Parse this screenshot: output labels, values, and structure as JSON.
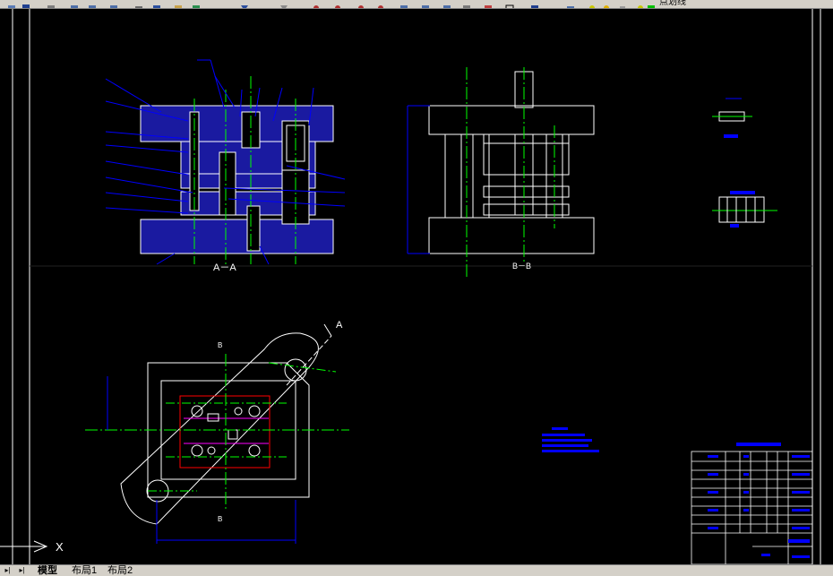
{
  "toolbar": {
    "layer_label": "点划线",
    "icons": [
      "zoom-realtime-icon",
      "zoom-window-icon",
      "zoom-previous-icon",
      "properties-icon",
      "design-center-icon",
      "tool-palette-icon",
      "sheet-set-icon",
      "markup-icon",
      "calculator-icon",
      "help-icon",
      "layer-icon",
      "light-bulb-icon",
      "sun-icon",
      "color-swatch-icon"
    ]
  },
  "drawing": {
    "section_a_label": "A－A",
    "section_b_label": "B－B",
    "view_a_label": "A",
    "view_b_label": "B",
    "ucs_x_label": "X"
  },
  "tabs": {
    "model": "模型",
    "layout1": "布局1",
    "layout2": "布局2"
  },
  "colors": {
    "outline": "#ffffff",
    "centerline": "#00ff00",
    "leader": "#0000ff",
    "hatch": "#2a2aff",
    "cut_line": "#ff0000",
    "magenta": "#ff00ff",
    "toolbar_bg": "#d4d0c8"
  }
}
